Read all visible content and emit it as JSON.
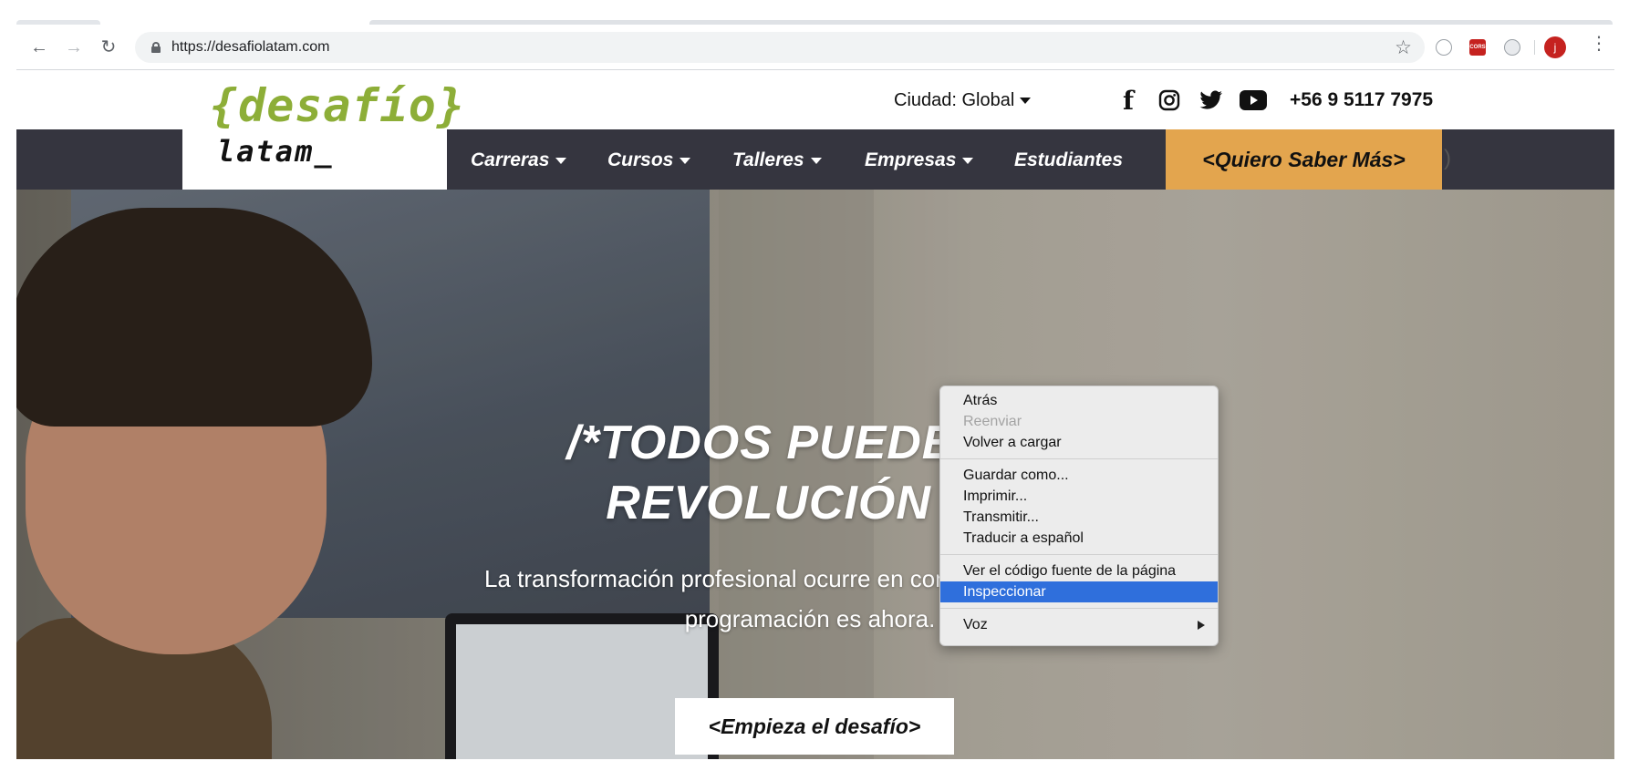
{
  "browser": {
    "url": "https://desafiolatam.com",
    "avatar_letter": "j",
    "extensions": [
      "face-icon",
      "cors-icon",
      "circle-icon"
    ],
    "cors_label": "CORS"
  },
  "header": {
    "city_label": "Ciudad: Global",
    "phone": "+56 9 5117 7975",
    "logo_top": "{desafío}",
    "logo_bottom": "latam_"
  },
  "nav": {
    "items": [
      {
        "label": "Carreras",
        "dropdown": true
      },
      {
        "label": "Cursos",
        "dropdown": true
      },
      {
        "label": "Talleres",
        "dropdown": true
      },
      {
        "label": "Empresas",
        "dropdown": true
      },
      {
        "label": "Estudiantes",
        "dropdown": false
      }
    ],
    "cta": "<Quiero Saber Más>"
  },
  "hero": {
    "title_line1": "/*TODOS PUEDEN SU",
    "title_line2": "REVOLUCIÓN DIG",
    "subtitle_line1": "La transformación profesional ocurre en comunidad. Aprender",
    "subtitle_line2": "programación es ahora.",
    "button": "<Empieza el desafío>"
  },
  "context_menu": {
    "groups": [
      [
        {
          "label": "Atrás",
          "disabled": false
        },
        {
          "label": "Reenviar",
          "disabled": true
        },
        {
          "label": "Volver a cargar",
          "disabled": false
        }
      ],
      [
        {
          "label": "Guardar como...",
          "disabled": false
        },
        {
          "label": "Imprimir...",
          "disabled": false
        },
        {
          "label": "Transmitir...",
          "disabled": false
        },
        {
          "label": "Traducir a español",
          "disabled": false
        }
      ],
      [
        {
          "label": "Ver el código fuente de la página",
          "disabled": false
        },
        {
          "label": "Inspeccionar",
          "disabled": false,
          "selected": true
        }
      ],
      [
        {
          "label": "Voz",
          "disabled": false,
          "submenu": true
        }
      ]
    ]
  },
  "colors": {
    "logo_green": "#8dae38",
    "navbar_bg": "#35353f",
    "cta_orange": "#e3a54e",
    "menu_highlight": "#2f6fdc"
  }
}
